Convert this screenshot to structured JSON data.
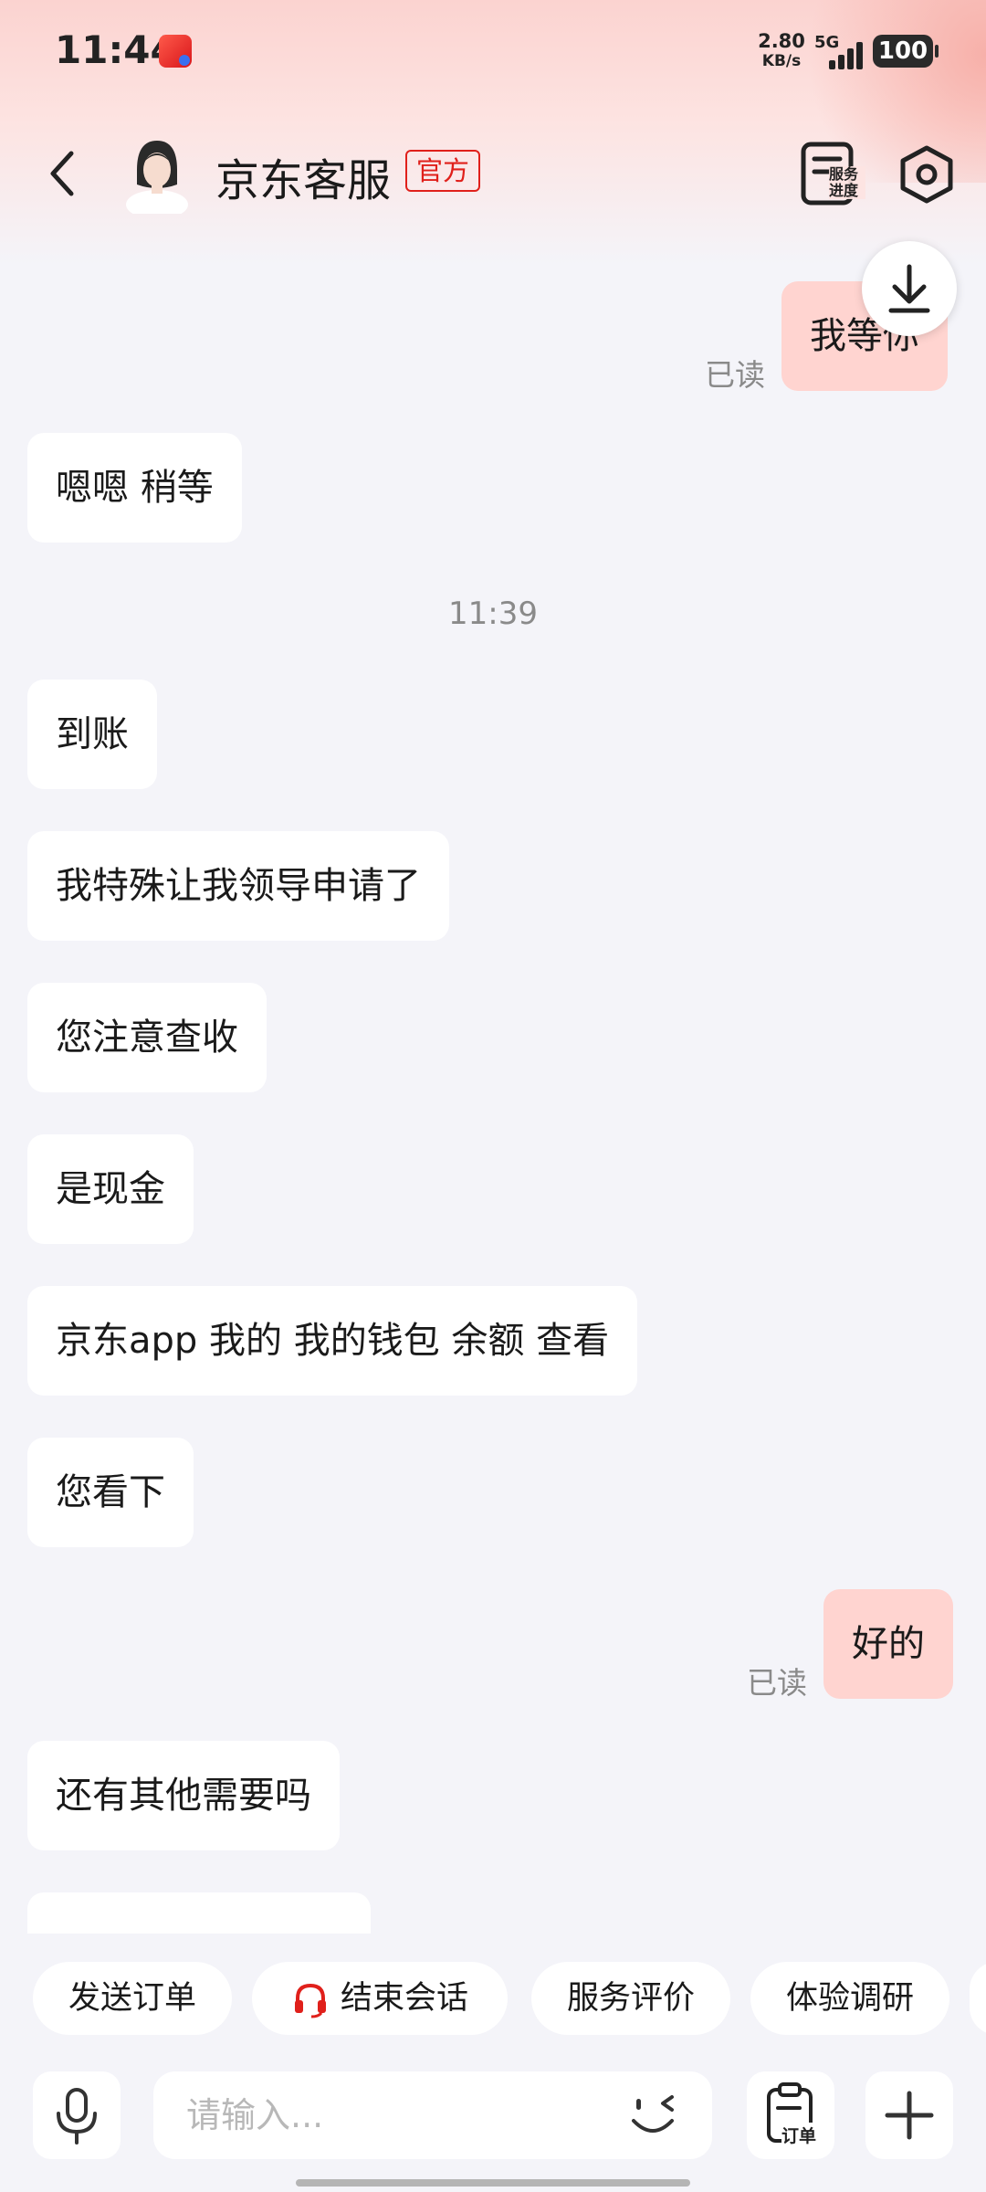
{
  "status_bar": {
    "time": "11:44",
    "net_speed_value": "2.80",
    "net_speed_unit": "KB/s",
    "network_type": "5G",
    "battery": "100"
  },
  "header": {
    "title": "京东客服",
    "official_tag": "官方",
    "service_progress_label": "服务进度"
  },
  "messages": [
    {
      "side": "out",
      "text": "我等你",
      "read": "已读"
    },
    {
      "side": "in",
      "text": "嗯嗯 稍等"
    },
    {
      "type": "time",
      "text": "11:39"
    },
    {
      "side": "in",
      "text": "到账"
    },
    {
      "side": "in",
      "text": "我特殊让我领导申请了"
    },
    {
      "side": "in",
      "text": "您注意查收"
    },
    {
      "side": "in",
      "text": "是现金"
    },
    {
      "side": "in",
      "text": "京东app 我的 我的钱包 余额 查看"
    },
    {
      "side": "in",
      "text": "您看下"
    },
    {
      "side": "out",
      "text": "好的",
      "read": "已读"
    },
    {
      "side": "in",
      "text": "还有其他需要吗"
    }
  ],
  "quick_actions": [
    {
      "label": "发送订单"
    },
    {
      "label": "结束会话",
      "icon": "headset-icon"
    },
    {
      "label": "服务评价"
    },
    {
      "label": "体验调研"
    }
  ],
  "input": {
    "placeholder": "请输入...",
    "order_label": "订单"
  },
  "colors": {
    "brand_red": "#e0201b",
    "outgoing_bubble": "#ffd4d0",
    "incoming_bubble": "#ffffff",
    "background": "#f4f4f9"
  }
}
